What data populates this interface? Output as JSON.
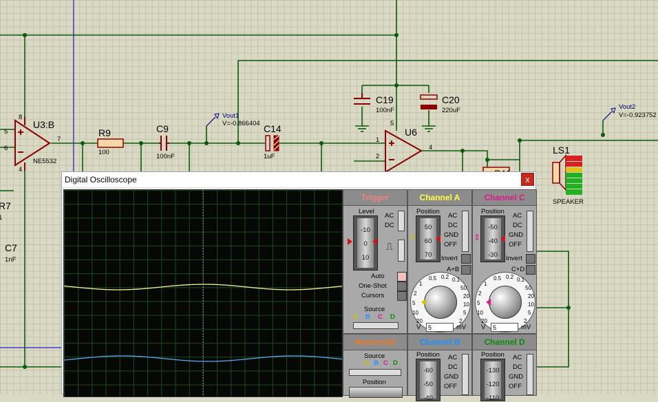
{
  "schematic": {
    "u3b": {
      "ref": "U3:B",
      "type": "NE5532",
      "pin_out": "7",
      "pin_inp": "5",
      "pin_inn": "6",
      "pin_top": "8",
      "pin_bot": "4"
    },
    "r9": {
      "ref": "R9",
      "value": "100"
    },
    "c9": {
      "ref": "C9",
      "value": "100nF"
    },
    "c14": {
      "ref": "C14",
      "value": "1uF"
    },
    "c19": {
      "ref": "C19",
      "value": "100nF"
    },
    "c20": {
      "ref": "C20",
      "value": "220uF"
    },
    "u6": {
      "ref": "U6",
      "pin_out": "4",
      "pin_inp": "1",
      "pin_inn": "2",
      "pin_top": "5"
    },
    "ls1": {
      "ref": "LS1",
      "type": "SPEAKER"
    },
    "r7": {
      "ref": "R7",
      "value": "1"
    },
    "c7": {
      "ref": "C7",
      "value": "1nF"
    },
    "vout1": {
      "name": "Vout1",
      "value": "V=-0.866404"
    },
    "vout2": {
      "name": "Vout2",
      "value": "V=-0.923752"
    },
    "r_partial": "R11"
  },
  "oscilloscope": {
    "title": "Digital Oscilloscope",
    "close_label": "x",
    "trigger": {
      "title": "Trigger",
      "level_label": "Level",
      "level_ticks": [
        "-10",
        "0",
        "10"
      ],
      "coupling": [
        "AC",
        "DC"
      ],
      "auto_label": "Auto",
      "oneshot_label": "One-Shot",
      "cursors_label": "Cursors",
      "source_label": "Source",
      "sources": [
        "A",
        "B",
        "C",
        "D"
      ]
    },
    "channel_a": {
      "title": "Channel A",
      "position_label": "Position",
      "ticks": [
        "50",
        "60",
        "70"
      ],
      "coupling": [
        "AC",
        "DC",
        "GND",
        "OFF"
      ],
      "invert_label": "Invert",
      "sum_label": "A+B",
      "dial_labels": [
        "0.5",
        "0.2",
        "0.1",
        "1",
        "50",
        "2",
        "20",
        "5",
        "10",
        "10",
        "5",
        "20",
        "2"
      ],
      "scale_value": "5",
      "unit_left": "V",
      "unit_right": "mV"
    },
    "channel_c": {
      "title": "Channel C",
      "position_label": "Position",
      "ticks": [
        "-50",
        "-40",
        "-30"
      ],
      "coupling": [
        "AC",
        "DC",
        "GND",
        "OFF"
      ],
      "invert_label": "Invert",
      "sum_label": "C+D",
      "dial_labels": [
        "0.5",
        "0.2",
        "0.1",
        "1",
        "50",
        "2",
        "20",
        "5",
        "10",
        "10",
        "5",
        "20",
        "2"
      ],
      "scale_value": "5",
      "unit_left": "V",
      "unit_right": "mV"
    },
    "horizontal": {
      "title": "Horizontal",
      "source_label": "Source",
      "sources": [
        "A",
        "B",
        "C",
        "D"
      ],
      "position_label": "Position"
    },
    "channel_b": {
      "title": "Channel B",
      "position_label": "Position",
      "ticks": [
        "-60",
        "-50",
        "-40"
      ],
      "coupling": [
        "AC",
        "DC",
        "GND",
        "OFF"
      ]
    },
    "channel_d": {
      "title": "Channel D",
      "position_label": "Position",
      "ticks": [
        "-130",
        "-120",
        "-110"
      ],
      "coupling": [
        "AC",
        "DC",
        "GND",
        "OFF"
      ]
    },
    "colors": {
      "trigger": "#f08080",
      "channel_a": "#ffff40",
      "channel_b": "#1e90ff",
      "channel_c": "#e0188a",
      "channel_d": "#0a8a0a",
      "horizontal": "#f07820",
      "trace_a": "#f4f49a",
      "trace_b": "#5aa8e8"
    }
  }
}
